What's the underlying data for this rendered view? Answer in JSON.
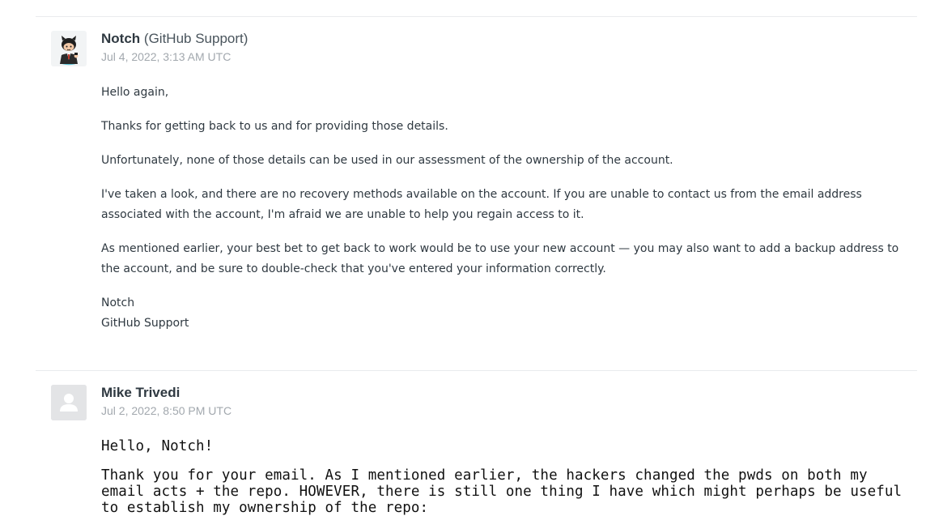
{
  "comments": [
    {
      "author": "Notch",
      "role": "(GitHub Support)",
      "timestamp": "Jul 4, 2022, 3:13 AM UTC",
      "avatar_icon": "octocat-agent-avatar",
      "paragraphs": [
        "Hello again,",
        "Thanks for getting back to us and for providing those details.",
        "Unfortunately, none of those details can be used in our assessment of the ownership of the account.",
        "I've taken a look, and there are no recovery methods available on the account. If you are unable to contact us from the email address associated with the account, I'm afraid we are unable to help you regain access to it.",
        "As mentioned earlier, your best bet to get back to work would be to use your new account — you may also want to add a backup address to the account, and be sure to double-check that you've entered your information correctly."
      ],
      "signature": [
        "Notch",
        "GitHub Support"
      ]
    },
    {
      "author": "Mike Trivedi",
      "timestamp": "Jul 2, 2022, 8:50 PM UTC",
      "avatar_icon": "default-user-avatar",
      "paragraphs": [
        "Hello, Notch!",
        "Thank you for your email.  As I mentioned earlier, the hackers changed the pwds on both my email acts + the repo.  HOWEVER, there is still one thing I have which might perhaps be useful to establish my ownership of the repo:"
      ]
    }
  ],
  "colors": {
    "divider": "#e9ebed",
    "timestamp": "#a2a8ae",
    "text": "#2f3941",
    "avatar_placeholder": "#e3e4e6"
  }
}
